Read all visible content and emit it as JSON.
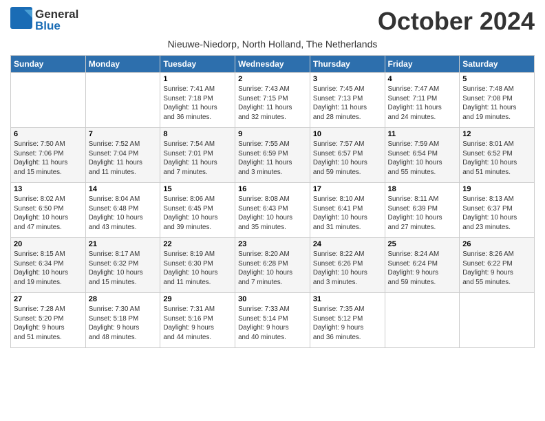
{
  "header": {
    "logo_general": "General",
    "logo_blue": "Blue",
    "month_title": "October 2024",
    "subtitle": "Nieuwe-Niedorp, North Holland, The Netherlands"
  },
  "weekdays": [
    "Sunday",
    "Monday",
    "Tuesday",
    "Wednesday",
    "Thursday",
    "Friday",
    "Saturday"
  ],
  "weeks": [
    [
      {
        "day": "",
        "sunrise": "",
        "sunset": "",
        "daylight": ""
      },
      {
        "day": "",
        "sunrise": "",
        "sunset": "",
        "daylight": ""
      },
      {
        "day": "1",
        "sunrise": "Sunrise: 7:41 AM",
        "sunset": "Sunset: 7:18 PM",
        "daylight": "Daylight: 11 hours and 36 minutes."
      },
      {
        "day": "2",
        "sunrise": "Sunrise: 7:43 AM",
        "sunset": "Sunset: 7:15 PM",
        "daylight": "Daylight: 11 hours and 32 minutes."
      },
      {
        "day": "3",
        "sunrise": "Sunrise: 7:45 AM",
        "sunset": "Sunset: 7:13 PM",
        "daylight": "Daylight: 11 hours and 28 minutes."
      },
      {
        "day": "4",
        "sunrise": "Sunrise: 7:47 AM",
        "sunset": "Sunset: 7:11 PM",
        "daylight": "Daylight: 11 hours and 24 minutes."
      },
      {
        "day": "5",
        "sunrise": "Sunrise: 7:48 AM",
        "sunset": "Sunset: 7:08 PM",
        "daylight": "Daylight: 11 hours and 19 minutes."
      }
    ],
    [
      {
        "day": "6",
        "sunrise": "Sunrise: 7:50 AM",
        "sunset": "Sunset: 7:06 PM",
        "daylight": "Daylight: 11 hours and 15 minutes."
      },
      {
        "day": "7",
        "sunrise": "Sunrise: 7:52 AM",
        "sunset": "Sunset: 7:04 PM",
        "daylight": "Daylight: 11 hours and 11 minutes."
      },
      {
        "day": "8",
        "sunrise": "Sunrise: 7:54 AM",
        "sunset": "Sunset: 7:01 PM",
        "daylight": "Daylight: 11 hours and 7 minutes."
      },
      {
        "day": "9",
        "sunrise": "Sunrise: 7:55 AM",
        "sunset": "Sunset: 6:59 PM",
        "daylight": "Daylight: 11 hours and 3 minutes."
      },
      {
        "day": "10",
        "sunrise": "Sunrise: 7:57 AM",
        "sunset": "Sunset: 6:57 PM",
        "daylight": "Daylight: 10 hours and 59 minutes."
      },
      {
        "day": "11",
        "sunrise": "Sunrise: 7:59 AM",
        "sunset": "Sunset: 6:54 PM",
        "daylight": "Daylight: 10 hours and 55 minutes."
      },
      {
        "day": "12",
        "sunrise": "Sunrise: 8:01 AM",
        "sunset": "Sunset: 6:52 PM",
        "daylight": "Daylight: 10 hours and 51 minutes."
      }
    ],
    [
      {
        "day": "13",
        "sunrise": "Sunrise: 8:02 AM",
        "sunset": "Sunset: 6:50 PM",
        "daylight": "Daylight: 10 hours and 47 minutes."
      },
      {
        "day": "14",
        "sunrise": "Sunrise: 8:04 AM",
        "sunset": "Sunset: 6:48 PM",
        "daylight": "Daylight: 10 hours and 43 minutes."
      },
      {
        "day": "15",
        "sunrise": "Sunrise: 8:06 AM",
        "sunset": "Sunset: 6:45 PM",
        "daylight": "Daylight: 10 hours and 39 minutes."
      },
      {
        "day": "16",
        "sunrise": "Sunrise: 8:08 AM",
        "sunset": "Sunset: 6:43 PM",
        "daylight": "Daylight: 10 hours and 35 minutes."
      },
      {
        "day": "17",
        "sunrise": "Sunrise: 8:10 AM",
        "sunset": "Sunset: 6:41 PM",
        "daylight": "Daylight: 10 hours and 31 minutes."
      },
      {
        "day": "18",
        "sunrise": "Sunrise: 8:11 AM",
        "sunset": "Sunset: 6:39 PM",
        "daylight": "Daylight: 10 hours and 27 minutes."
      },
      {
        "day": "19",
        "sunrise": "Sunrise: 8:13 AM",
        "sunset": "Sunset: 6:37 PM",
        "daylight": "Daylight: 10 hours and 23 minutes."
      }
    ],
    [
      {
        "day": "20",
        "sunrise": "Sunrise: 8:15 AM",
        "sunset": "Sunset: 6:34 PM",
        "daylight": "Daylight: 10 hours and 19 minutes."
      },
      {
        "day": "21",
        "sunrise": "Sunrise: 8:17 AM",
        "sunset": "Sunset: 6:32 PM",
        "daylight": "Daylight: 10 hours and 15 minutes."
      },
      {
        "day": "22",
        "sunrise": "Sunrise: 8:19 AM",
        "sunset": "Sunset: 6:30 PM",
        "daylight": "Daylight: 10 hours and 11 minutes."
      },
      {
        "day": "23",
        "sunrise": "Sunrise: 8:20 AM",
        "sunset": "Sunset: 6:28 PM",
        "daylight": "Daylight: 10 hours and 7 minutes."
      },
      {
        "day": "24",
        "sunrise": "Sunrise: 8:22 AM",
        "sunset": "Sunset: 6:26 PM",
        "daylight": "Daylight: 10 hours and 3 minutes."
      },
      {
        "day": "25",
        "sunrise": "Sunrise: 8:24 AM",
        "sunset": "Sunset: 6:24 PM",
        "daylight": "Daylight: 9 hours and 59 minutes."
      },
      {
        "day": "26",
        "sunrise": "Sunrise: 8:26 AM",
        "sunset": "Sunset: 6:22 PM",
        "daylight": "Daylight: 9 hours and 55 minutes."
      }
    ],
    [
      {
        "day": "27",
        "sunrise": "Sunrise: 7:28 AM",
        "sunset": "Sunset: 5:20 PM",
        "daylight": "Daylight: 9 hours and 51 minutes."
      },
      {
        "day": "28",
        "sunrise": "Sunrise: 7:30 AM",
        "sunset": "Sunset: 5:18 PM",
        "daylight": "Daylight: 9 hours and 48 minutes."
      },
      {
        "day": "29",
        "sunrise": "Sunrise: 7:31 AM",
        "sunset": "Sunset: 5:16 PM",
        "daylight": "Daylight: 9 hours and 44 minutes."
      },
      {
        "day": "30",
        "sunrise": "Sunrise: 7:33 AM",
        "sunset": "Sunset: 5:14 PM",
        "daylight": "Daylight: 9 hours and 40 minutes."
      },
      {
        "day": "31",
        "sunrise": "Sunrise: 7:35 AM",
        "sunset": "Sunset: 5:12 PM",
        "daylight": "Daylight: 9 hours and 36 minutes."
      },
      {
        "day": "",
        "sunrise": "",
        "sunset": "",
        "daylight": ""
      },
      {
        "day": "",
        "sunrise": "",
        "sunset": "",
        "daylight": ""
      }
    ]
  ]
}
